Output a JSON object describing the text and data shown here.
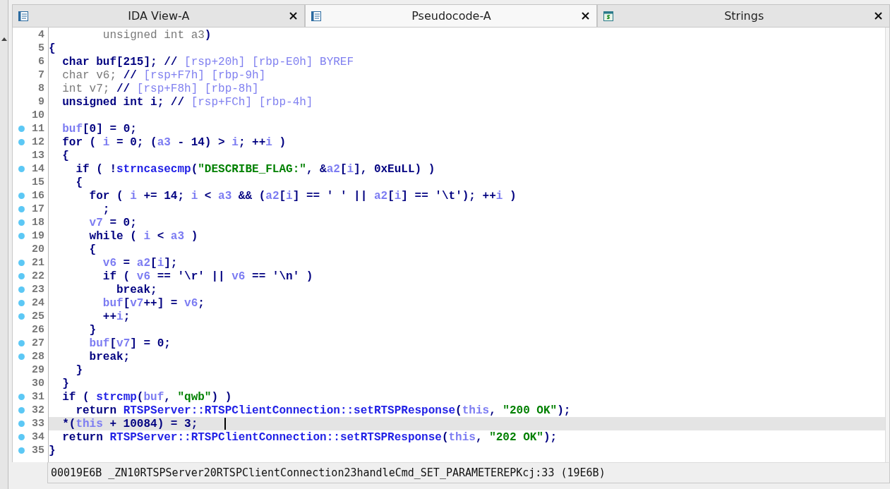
{
  "tabs": [
    {
      "label": "IDA View-A",
      "kind": "disasm",
      "selected": false
    },
    {
      "label": "Pseudocode-A",
      "kind": "pseudo",
      "selected": true
    },
    {
      "label": "Strings",
      "kind": "strings",
      "selected": false
    }
  ],
  "code_lines": [
    {
      "number": "4",
      "marked": false,
      "current": false,
      "tokens": [
        {
          "kind": "dim",
          "text": "        unsigned int a3"
        },
        {
          "kind": "kw",
          "text": ")"
        }
      ]
    },
    {
      "number": "5",
      "marked": false,
      "current": false,
      "tokens": [
        {
          "kind": "kw",
          "text": "{"
        }
      ]
    },
    {
      "number": "6",
      "marked": false,
      "current": false,
      "tokens": [
        {
          "kind": "kw",
          "text": "  char buf[215]; // "
        },
        {
          "kind": "cmt",
          "text": "[rsp+20h] [rbp-E0h] BYREF"
        }
      ]
    },
    {
      "number": "7",
      "marked": false,
      "current": false,
      "tokens": [
        {
          "kind": "dim",
          "text": "  char v6; "
        },
        {
          "kind": "kw",
          "text": "// "
        },
        {
          "kind": "cmt",
          "text": "[rsp+F7h] [rbp-9h]"
        }
      ]
    },
    {
      "number": "8",
      "marked": false,
      "current": false,
      "tokens": [
        {
          "kind": "dim",
          "text": "  int v7; "
        },
        {
          "kind": "kw",
          "text": "// "
        },
        {
          "kind": "cmt",
          "text": "[rsp+F8h] [rbp-8h]"
        }
      ]
    },
    {
      "number": "9",
      "marked": false,
      "current": false,
      "tokens": [
        {
          "kind": "kw",
          "text": "  unsigned int i; // "
        },
        {
          "kind": "cmt",
          "text": "[rsp+FCh] [rbp-4h]"
        }
      ]
    },
    {
      "number": "10",
      "marked": false,
      "current": false
    },
    {
      "number": "11",
      "marked": true,
      "current": false,
      "tokens": [
        {
          "kind": "var",
          "text": "  buf"
        },
        {
          "kind": "kw",
          "text": "[0] = 0;"
        }
      ]
    },
    {
      "number": "12",
      "marked": true,
      "current": false,
      "tokens": [
        {
          "kind": "kw",
          "text": "  for ( "
        },
        {
          "kind": "var",
          "text": "i"
        },
        {
          "kind": "kw",
          "text": " = 0; ("
        },
        {
          "kind": "var",
          "text": "a3"
        },
        {
          "kind": "kw",
          "text": " - 14) > "
        },
        {
          "kind": "var",
          "text": "i"
        },
        {
          "kind": "kw",
          "text": "; ++"
        },
        {
          "kind": "var",
          "text": "i"
        },
        {
          "kind": "kw",
          "text": " )"
        }
      ]
    },
    {
      "number": "13",
      "marked": false,
      "current": false,
      "tokens": [
        {
          "kind": "kw",
          "text": "  {"
        }
      ]
    },
    {
      "number": "14",
      "marked": true,
      "current": false,
      "tokens": [
        {
          "kind": "kw",
          "text": "    if ( !"
        },
        {
          "kind": "fn",
          "text": "strncasecmp"
        },
        {
          "kind": "kw",
          "text": "("
        },
        {
          "kind": "str",
          "text": "\"DESCRIBE_FLAG:\""
        },
        {
          "kind": "kw",
          "text": ", &"
        },
        {
          "kind": "var",
          "text": "a2"
        },
        {
          "kind": "kw",
          "text": "["
        },
        {
          "kind": "var",
          "text": "i"
        },
        {
          "kind": "kw",
          "text": "], 0xEuLL) )"
        }
      ]
    },
    {
      "number": "15",
      "marked": false,
      "current": false,
      "tokens": [
        {
          "kind": "kw",
          "text": "    {"
        }
      ]
    },
    {
      "number": "16",
      "marked": true,
      "current": false,
      "tokens": [
        {
          "kind": "kw",
          "text": "      for ( "
        },
        {
          "kind": "var",
          "text": "i"
        },
        {
          "kind": "kw",
          "text": " += 14; "
        },
        {
          "kind": "var",
          "text": "i"
        },
        {
          "kind": "kw",
          "text": " < "
        },
        {
          "kind": "var",
          "text": "a3"
        },
        {
          "kind": "kw",
          "text": " && ("
        },
        {
          "kind": "var",
          "text": "a2"
        },
        {
          "kind": "kw",
          "text": "["
        },
        {
          "kind": "var",
          "text": "i"
        },
        {
          "kind": "kw",
          "text": "] == ' ' || "
        },
        {
          "kind": "var",
          "text": "a2"
        },
        {
          "kind": "kw",
          "text": "["
        },
        {
          "kind": "var",
          "text": "i"
        },
        {
          "kind": "kw",
          "text": "] == '\\t'); ++"
        },
        {
          "kind": "var",
          "text": "i"
        },
        {
          "kind": "kw",
          "text": " )"
        }
      ]
    },
    {
      "number": "17",
      "marked": true,
      "current": false,
      "tokens": [
        {
          "kind": "kw",
          "text": "        ;"
        }
      ]
    },
    {
      "number": "18",
      "marked": true,
      "current": false,
      "tokens": [
        {
          "kind": "var",
          "text": "      v7"
        },
        {
          "kind": "kw",
          "text": " = 0;"
        }
      ]
    },
    {
      "number": "19",
      "marked": true,
      "current": false,
      "tokens": [
        {
          "kind": "kw",
          "text": "      while ( "
        },
        {
          "kind": "var",
          "text": "i"
        },
        {
          "kind": "kw",
          "text": " < "
        },
        {
          "kind": "var",
          "text": "a3"
        },
        {
          "kind": "kw",
          "text": " )"
        }
      ]
    },
    {
      "number": "20",
      "marked": false,
      "current": false,
      "tokens": [
        {
          "kind": "kw",
          "text": "      {"
        }
      ]
    },
    {
      "number": "21",
      "marked": true,
      "current": false,
      "tokens": [
        {
          "kind": "var",
          "text": "        v6"
        },
        {
          "kind": "kw",
          "text": " = "
        },
        {
          "kind": "var",
          "text": "a2"
        },
        {
          "kind": "kw",
          "text": "["
        },
        {
          "kind": "var",
          "text": "i"
        },
        {
          "kind": "kw",
          "text": "];"
        }
      ]
    },
    {
      "number": "22",
      "marked": true,
      "current": false,
      "tokens": [
        {
          "kind": "kw",
          "text": "        if ( "
        },
        {
          "kind": "var",
          "text": "v6"
        },
        {
          "kind": "kw",
          "text": " == '\\r' || "
        },
        {
          "kind": "var",
          "text": "v6"
        },
        {
          "kind": "kw",
          "text": " == '\\n' )"
        }
      ]
    },
    {
      "number": "23",
      "marked": true,
      "current": false,
      "tokens": [
        {
          "kind": "kw",
          "text": "          break;"
        }
      ]
    },
    {
      "number": "24",
      "marked": true,
      "current": false,
      "tokens": [
        {
          "kind": "var",
          "text": "        buf"
        },
        {
          "kind": "kw",
          "text": "["
        },
        {
          "kind": "var",
          "text": "v7"
        },
        {
          "kind": "kw",
          "text": "++] = "
        },
        {
          "kind": "var",
          "text": "v6"
        },
        {
          "kind": "kw",
          "text": ";"
        }
      ]
    },
    {
      "number": "25",
      "marked": true,
      "current": false,
      "tokens": [
        {
          "kind": "kw",
          "text": "        ++"
        },
        {
          "kind": "var",
          "text": "i"
        },
        {
          "kind": "kw",
          "text": ";"
        }
      ]
    },
    {
      "number": "26",
      "marked": false,
      "current": false,
      "tokens": [
        {
          "kind": "kw",
          "text": "      }"
        }
      ]
    },
    {
      "number": "27",
      "marked": true,
      "current": false,
      "tokens": [
        {
          "kind": "var",
          "text": "      buf"
        },
        {
          "kind": "kw",
          "text": "["
        },
        {
          "kind": "var",
          "text": "v7"
        },
        {
          "kind": "kw",
          "text": "] = 0;"
        }
      ]
    },
    {
      "number": "28",
      "marked": true,
      "current": false,
      "tokens": [
        {
          "kind": "kw",
          "text": "      break;"
        }
      ]
    },
    {
      "number": "29",
      "marked": false,
      "current": false,
      "tokens": [
        {
          "kind": "kw",
          "text": "    }"
        }
      ]
    },
    {
      "number": "30",
      "marked": false,
      "current": false,
      "tokens": [
        {
          "kind": "kw",
          "text": "  }"
        }
      ]
    },
    {
      "number": "31",
      "marked": true,
      "current": false,
      "tokens": [
        {
          "kind": "kw",
          "text": "  if ( "
        },
        {
          "kind": "fn",
          "text": "strcmp"
        },
        {
          "kind": "kw",
          "text": "("
        },
        {
          "kind": "var",
          "text": "buf"
        },
        {
          "kind": "kw",
          "text": ", "
        },
        {
          "kind": "str",
          "text": "\"qwb\""
        },
        {
          "kind": "kw",
          "text": ") )"
        }
      ]
    },
    {
      "number": "32",
      "marked": true,
      "current": false,
      "tokens": [
        {
          "kind": "kw",
          "text": "    return "
        },
        {
          "kind": "fn",
          "text": "RTSPServer::RTSPClientConnection::setRTSPResponse"
        },
        {
          "kind": "kw",
          "text": "("
        },
        {
          "kind": "var",
          "text": "this"
        },
        {
          "kind": "kw",
          "text": ", "
        },
        {
          "kind": "str",
          "text": "\"200 OK\""
        },
        {
          "kind": "kw",
          "text": ");"
        }
      ]
    },
    {
      "number": "33",
      "marked": true,
      "current": true,
      "tokens": [
        {
          "kind": "kw",
          "text": "  *("
        },
        {
          "kind": "var",
          "text": "this"
        },
        {
          "kind": "kw",
          "text": " + 10084) = 3;"
        }
      ]
    },
    {
      "number": "34",
      "marked": true,
      "current": false,
      "tokens": [
        {
          "kind": "kw",
          "text": "  return "
        },
        {
          "kind": "fn",
          "text": "RTSPServer::RTSPClientConnection::setRTSPResponse"
        },
        {
          "kind": "kw",
          "text": "("
        },
        {
          "kind": "var",
          "text": "this"
        },
        {
          "kind": "kw",
          "text": ", "
        },
        {
          "kind": "str",
          "text": "\"202 OK\""
        },
        {
          "kind": "kw",
          "text": ");"
        }
      ]
    },
    {
      "number": "35",
      "marked": true,
      "current": false,
      "tokens": [
        {
          "kind": "kw",
          "text": "}"
        }
      ]
    }
  ],
  "status_bar": "00019E6B _ZN10RTSPServer20RTSPClientConnection23handleCmd_SET_PARAMETEREPKcj:33 (19E6B)"
}
